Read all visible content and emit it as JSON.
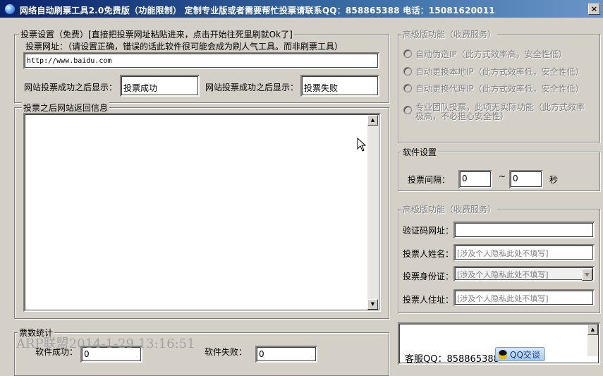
{
  "window": {
    "title": "网络自动刷票工具2.0免费版（功能限制）     定制专业版或者需要帮忙投票请联系QQ：858865388   电话：15081620011",
    "close_glyph": "×"
  },
  "vote_settings": {
    "legend": "投票设置（免费）[直接把投票网址粘贴进来，点击开始往死里刷就Ok了]",
    "url_label": "投票网址：（请设置正确，错误的话此软件很可能会成为刷人气工具。而非刷票工具）",
    "url_value": "http://www.baidu.com",
    "success_label": "网站投票成功之后显示：",
    "success_value": "投票成功",
    "fail_label": "网站投票成功之后显示：",
    "fail_value": "投票失败"
  },
  "response": {
    "legend": "投票之后网站返回信息",
    "content": ""
  },
  "stats": {
    "legend": "票数统计",
    "success_label": "软件成功：",
    "success_value": "0",
    "fail_label": "软件失败：",
    "fail_value": "0"
  },
  "premium": {
    "legend": "高级版功能（收费服务）",
    "options": [
      "自动伪造IP（此方式效率高，安全性低）",
      "自动更换本地IP（此方式效率低，安全性低）",
      "自动更换代理IP（此方式效率低，安全性低）",
      "专业团队投票，此项无实际功能（此方式效率",
      "极高，不必担心安全性）"
    ]
  },
  "software_settings": {
    "legend": "软件设置",
    "interval_label": "投票间隔：",
    "min_value": "0",
    "tilde": "~",
    "max_value": "0",
    "unit": "秒"
  },
  "premium2": {
    "legend": "高级版功能（收费服务）",
    "captcha_label": "验证码网址：",
    "captcha_value": "",
    "name_label": "投票人姓名：",
    "name_placeholder": "[涉及个人隐私此处不填写]",
    "id_label": "投票身份证：",
    "id_placeholder": "[涉及个人隐私此处不填写]",
    "address_label": "投票人住址：",
    "address_placeholder": "[涉及个人隐私此处不填写]"
  },
  "info_panel": {
    "text_partial": "客服QQ：858865388",
    "qq_button": "QQ交谈"
  },
  "watermark": "ARP联盟2014-1-29 13:16:51"
}
